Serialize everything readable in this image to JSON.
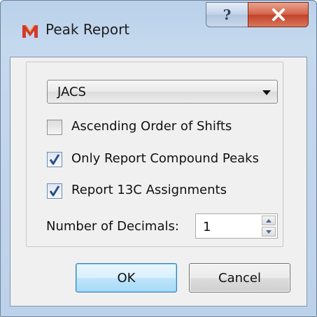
{
  "window": {
    "title": "Peak Report",
    "help_glyph": "?",
    "icon": "app-logo-icon"
  },
  "report_format": {
    "selected": "JACS"
  },
  "options": {
    "ascending_order": {
      "label": "Ascending Order of Shifts",
      "checked": false
    },
    "compound_peaks": {
      "label": "Only Report Compound Peaks",
      "checked": true
    },
    "c13_assignments": {
      "label": "Report 13C Assignments",
      "checked": true
    }
  },
  "decimals": {
    "label": "Number of Decimals:",
    "value": "1"
  },
  "buttons": {
    "ok": "OK",
    "cancel": "Cancel"
  },
  "colors": {
    "title_bar": "#c4d8ee",
    "close_button": "#c2432a",
    "default_button": "#bee6fd",
    "check_mark": "#2b4f86"
  }
}
